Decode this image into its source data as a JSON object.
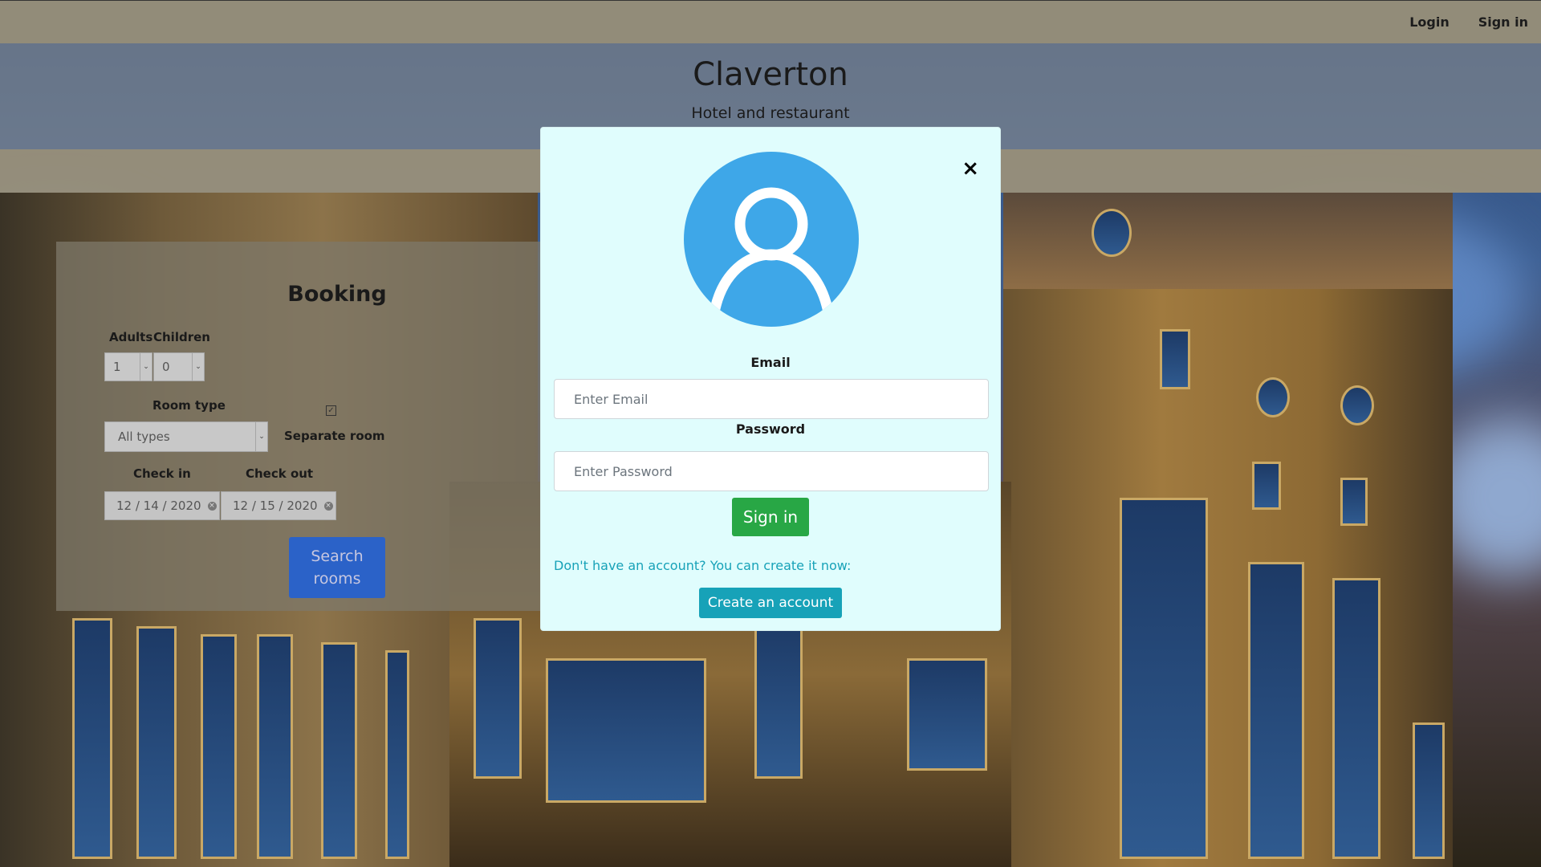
{
  "header": {
    "nav": {
      "login": "Login",
      "sign_in": "Sign in"
    },
    "brand": "Claverton",
    "tagline": "Hotel and restaurant"
  },
  "booking": {
    "title": "Booking",
    "adults_label": "Adults",
    "children_label": "Children",
    "adults_value": "1",
    "children_value": "0",
    "room_type_label": "Room type",
    "room_type_value": "All types",
    "separate_room_label": "Separate room",
    "separate_room_checked": true,
    "check_in_label": "Check in",
    "check_out_label": "Check out",
    "check_in_value": "12 / 14 / 2020",
    "check_out_value": "12 / 15 / 2020",
    "search_button": "Search rooms"
  },
  "login_modal": {
    "close_symbol": "×",
    "email_label": "Email",
    "email_placeholder": "Enter Email",
    "password_label": "Password",
    "password_placeholder": "Enter Password",
    "sign_in_button": "Sign in",
    "no_account_text": "Don't have an account? You can create it now:",
    "create_account_button": "Create an account"
  },
  "colors": {
    "modal_bg": "#e0fdfd",
    "avatar_bg": "#3ea7e8",
    "sign_in_bg": "#28a745",
    "create_bg": "#17a2b8",
    "search_bg": "#2b62c8"
  },
  "icons": {
    "avatar": "user-avatar-icon",
    "close": "close-icon",
    "dropdown": "chevron-down-icon",
    "clear_date": "clear-icon",
    "checkbox": "checkbox-icon"
  }
}
